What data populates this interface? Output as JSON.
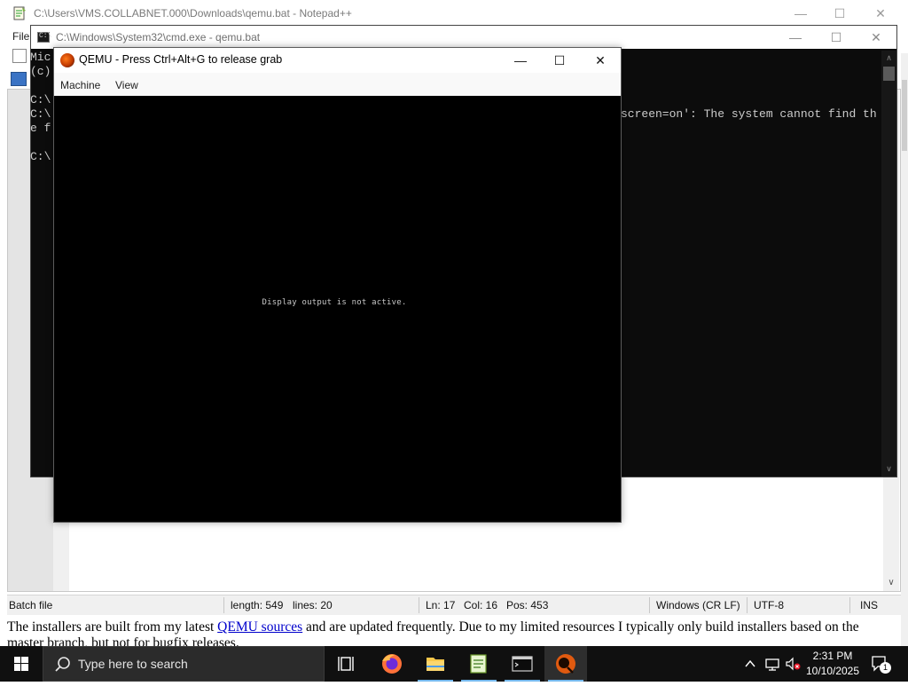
{
  "notepadpp": {
    "title": "C:\\Users\\VMS.COLLABNET.000\\Downloads\\qemu.bat - Notepad++",
    "menu_file": "File",
    "status": {
      "type": "Batch file",
      "length": "length: 549",
      "lines": "lines: 20",
      "ln": "Ln: 17",
      "col": "Col: 16",
      "pos": "Pos: 453",
      "eol": "Windows (CR LF)",
      "encoding": "UTF-8",
      "mode": "INS"
    }
  },
  "cmd": {
    "title": "C:\\Windows\\System32\\cmd.exe - qemu.bat",
    "lines_left": [
      "Mic",
      "(c)",
      "",
      "C:\\",
      "C:\\",
      "e f",
      "",
      "C:\\"
    ],
    "error_line_1": "screen=on': The system cannot find th",
    "error_line_2": ""
  },
  "qemu": {
    "title": "QEMU - Press Ctrl+Alt+G to release grab",
    "menu": [
      "Machine",
      "View"
    ],
    "display_message": "Display output is not active."
  },
  "web": {
    "text_before_link": "The installers are built from my latest ",
    "link_text": "QEMU sources",
    "text_after_link": " and are updated frequently. Due to my limited resources I typically only build installers based on the master branch, but not for bugfix releases."
  },
  "taskbar": {
    "search_placeholder": "Type here to search",
    "time": "2:31 PM",
    "date": "10/10/2025",
    "notification_count": "1",
    "apps": [
      "task-view-icon",
      "firefox-icon",
      "file-explorer-icon",
      "notepadpp-icon",
      "cmd-icon",
      "qemu-icon"
    ]
  },
  "colors": {
    "cmd_bg": "#0c0c0c",
    "taskbar_bg": "#101010",
    "link": "#0000cc",
    "active_indicator": "#76b9ed"
  }
}
